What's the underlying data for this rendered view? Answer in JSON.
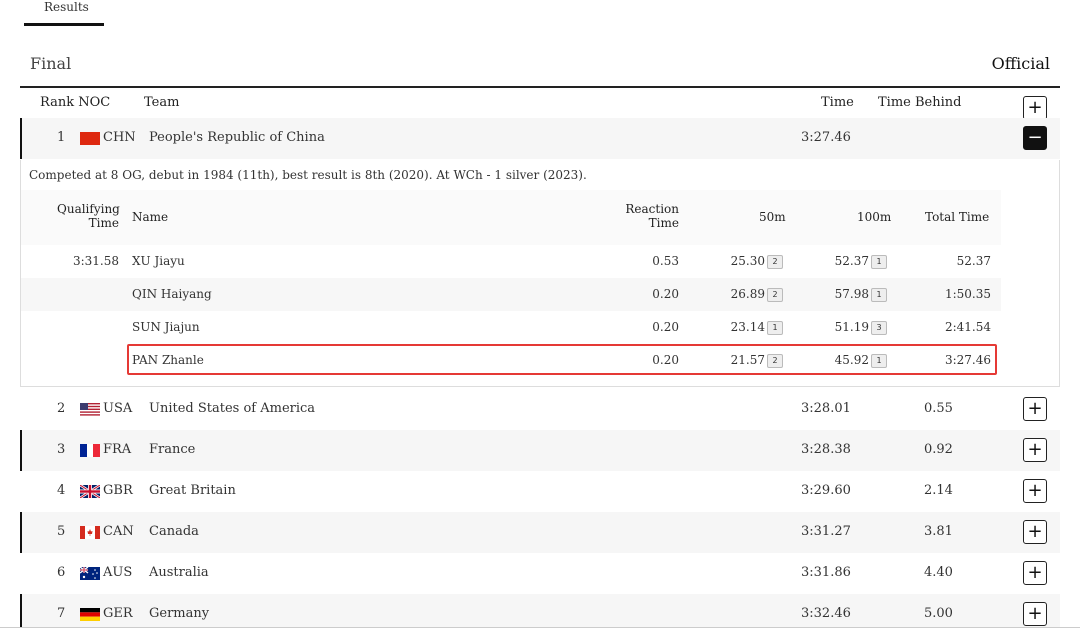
{
  "tab": {
    "label": "Results"
  },
  "section": {
    "title": "Final",
    "status": "Official"
  },
  "table": {
    "headers": {
      "rank_noc": "Rank NOC",
      "team": "Team",
      "time": "Time",
      "time_behind": "Time Behind"
    },
    "rows": [
      {
        "rank": "1",
        "noc": "CHN",
        "team": "People's Republic of China",
        "time": "3:27.46",
        "behind": "",
        "toggle": "−"
      },
      {
        "rank": "2",
        "noc": "USA",
        "team": "United States of America",
        "time": "3:28.01",
        "behind": "0.55",
        "toggle": "+"
      },
      {
        "rank": "3",
        "noc": "FRA",
        "team": "France",
        "time": "3:28.38",
        "behind": "0.92",
        "toggle": "+"
      },
      {
        "rank": "4",
        "noc": "GBR",
        "team": "Great Britain",
        "time": "3:29.60",
        "behind": "2.14",
        "toggle": "+"
      },
      {
        "rank": "5",
        "noc": "CAN",
        "team": "Canada",
        "time": "3:31.27",
        "behind": "3.81",
        "toggle": "+"
      },
      {
        "rank": "6",
        "noc": "AUS",
        "team": "Australia",
        "time": "3:31.86",
        "behind": "4.40",
        "toggle": "+"
      },
      {
        "rank": "7",
        "noc": "GER",
        "team": "Germany",
        "time": "3:32.46",
        "behind": "5.00",
        "toggle": "+"
      }
    ],
    "header_toggle": "+"
  },
  "expanded": {
    "bio": "Competed at 8 OG, debut in 1984 (11th), best result is 8th (2020). At WCh - 1 silver (2023).",
    "headers": {
      "qual_line1": "Qualifying",
      "qual_line2": "Time",
      "name": "Name",
      "react_line1": "Reaction",
      "react_line2": "Time",
      "m50": "50m",
      "m100": "100m",
      "total": "Total Time"
    },
    "swimmers": [
      {
        "qual": "3:31.58",
        "name": "XU Jiayu",
        "reaction": "0.53",
        "m50": "25.30",
        "m50_rank": "2",
        "m100": "52.37",
        "m100_rank": "1",
        "total": "52.37"
      },
      {
        "qual": "",
        "name": "QIN Haiyang",
        "reaction": "0.20",
        "m50": "26.89",
        "m50_rank": "2",
        "m100": "57.98",
        "m100_rank": "1",
        "total": "1:50.35"
      },
      {
        "qual": "",
        "name": "SUN Jiajun",
        "reaction": "0.20",
        "m50": "23.14",
        "m50_rank": "1",
        "m100": "51.19",
        "m100_rank": "3",
        "total": "2:41.54"
      },
      {
        "qual": "",
        "name": "PAN Zhanle",
        "reaction": "0.20",
        "m50": "21.57",
        "m50_rank": "2",
        "m100": "45.92",
        "m100_rank": "1",
        "total": "3:27.46"
      }
    ]
  },
  "colors": {
    "highlight": "#e53935",
    "accent": "#111111"
  }
}
